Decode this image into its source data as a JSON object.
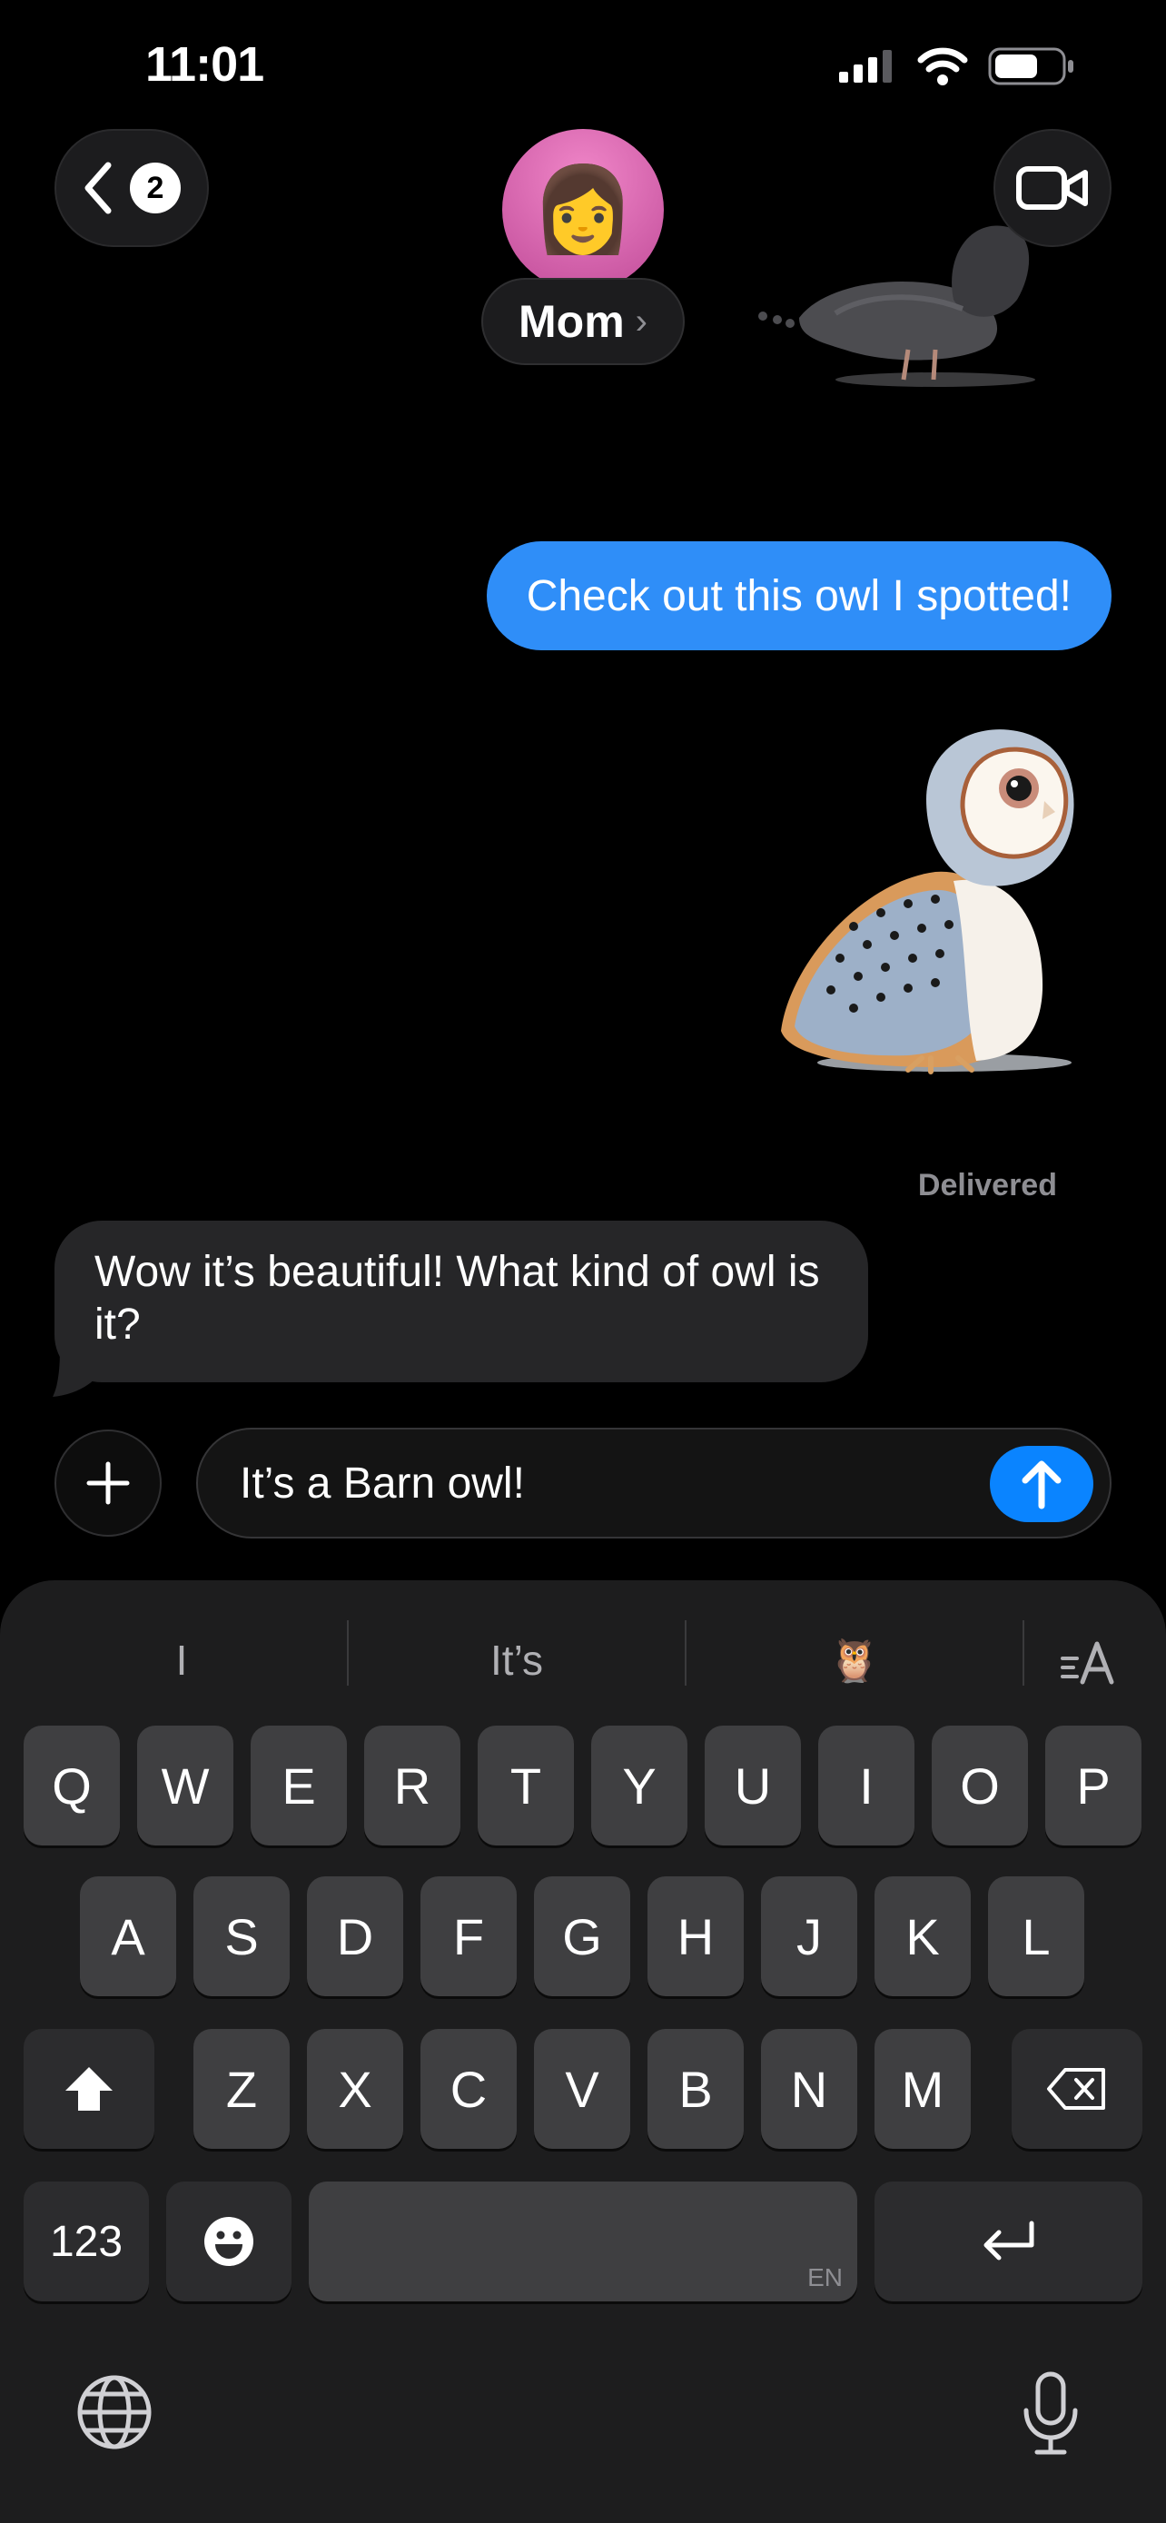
{
  "status_bar": {
    "time": "11:01"
  },
  "header": {
    "back_badge": "2",
    "contact_name": "Mom",
    "avatar_emoji": "👩"
  },
  "messages": {
    "outgoing": "Check out this owl I spotted!",
    "delivered": "Delivered",
    "incoming": "Wow it’s beautiful! What kind of owl is it?"
  },
  "composer": {
    "text": "It’s a Barn owl!"
  },
  "suggestions": [
    "I",
    "It’s",
    "🦉"
  ],
  "keyboard": {
    "row1": [
      "Q",
      "W",
      "E",
      "R",
      "T",
      "Y",
      "U",
      "I",
      "O",
      "P"
    ],
    "row2": [
      "A",
      "S",
      "D",
      "F",
      "G",
      "H",
      "J",
      "K",
      "L"
    ],
    "row3": [
      "Z",
      "X",
      "C",
      "V",
      "B",
      "N",
      "M"
    ],
    "numbers_label": "123",
    "space_language": "EN"
  },
  "colors": {
    "accent": "#0a84ff",
    "outgoing_bubble": "#2f8ef8",
    "incoming_bubble": "#262628"
  }
}
